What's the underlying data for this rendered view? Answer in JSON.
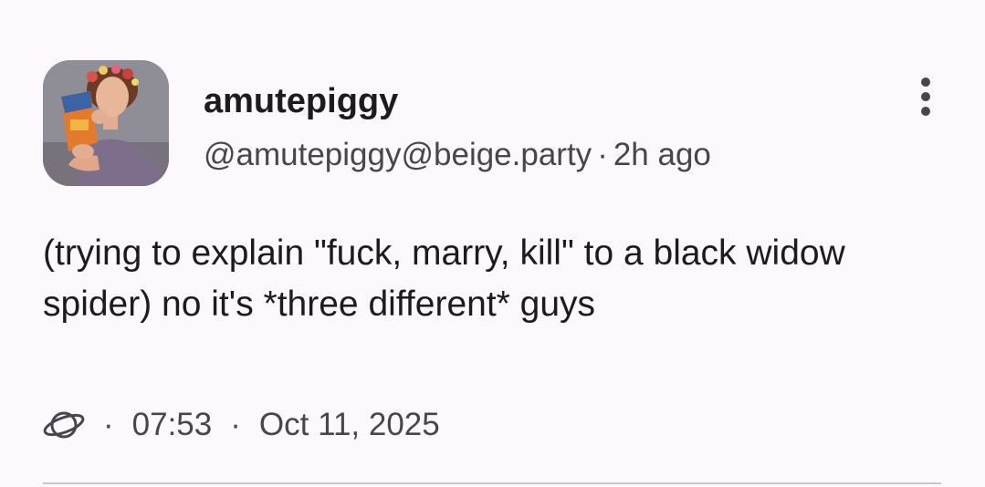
{
  "post": {
    "display_name": "amutepiggy",
    "handle": "@amutepiggy@beige.party",
    "separator": "·",
    "relative_time": "2h ago",
    "content": "(trying to explain \"fuck, marry, kill\" to a black widow spider) no it's *three different* guys",
    "visibility_icon": "planet-icon",
    "time": "07:53",
    "date": "Oct 11, 2025",
    "more_icon": "more-vert-icon"
  }
}
